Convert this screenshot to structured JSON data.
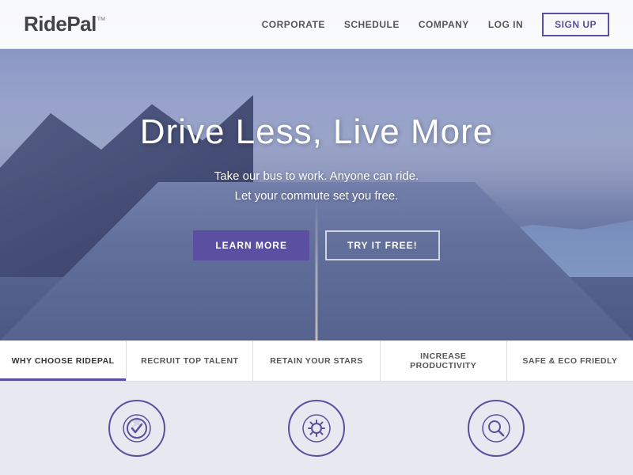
{
  "header": {
    "logo": "RidePal",
    "logo_tm": "™",
    "nav_items": [
      {
        "label": "CORPORATE",
        "id": "corporate"
      },
      {
        "label": "SCHEDULE",
        "id": "schedule"
      },
      {
        "label": "COMPANY",
        "id": "company"
      },
      {
        "label": "LOG IN",
        "id": "login"
      }
    ],
    "signup_label": "SIGN UP"
  },
  "hero": {
    "title": "Drive Less, Live More",
    "subtitle_line1": "Take our bus to work. Anyone can ride.",
    "subtitle_line2": "Let your commute set you free.",
    "btn_learn": "LEARN MORE",
    "btn_try": "TRY IT FREE!"
  },
  "tabs": [
    {
      "label": "WHY CHOOSE RIDEPAL",
      "active": true
    },
    {
      "label": "RECRUIT TOP TALENT",
      "active": false
    },
    {
      "label": "RETAIN YOUR STARS",
      "active": false
    },
    {
      "label": "INCREASE PRODUCTIVITY",
      "active": false
    },
    {
      "label": "SAFE & ECO FRIEDLY",
      "active": false
    }
  ],
  "features": {
    "icons": [
      {
        "name": "badge-check-icon",
        "symbol": "✓",
        "style": "circle-check"
      },
      {
        "name": "gear-settings-icon",
        "symbol": "⚙",
        "style": "gear"
      },
      {
        "name": "search-icon",
        "symbol": "🔍",
        "style": "search"
      }
    ]
  },
  "colors": {
    "accent": "#5a4fa0",
    "text_dark": "#333",
    "text_mid": "#555",
    "bg_features": "#e8e8f0",
    "border": "#ddd"
  }
}
